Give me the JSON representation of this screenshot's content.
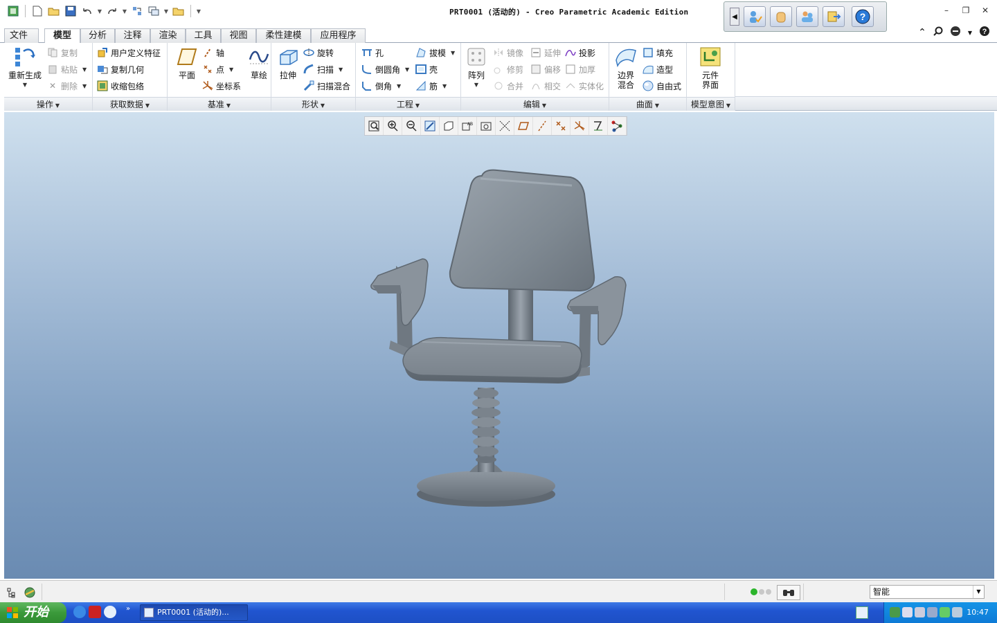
{
  "window": {
    "title": "PRT0001 (活动的) - Creo Parametric Academic Edition"
  },
  "ribbon_tabs": [
    {
      "label": "文件",
      "has_dropdown": true
    },
    {
      "label": "模型",
      "active": true
    },
    {
      "label": "分析"
    },
    {
      "label": "注释"
    },
    {
      "label": "渲染"
    },
    {
      "label": "工具"
    },
    {
      "label": "视图"
    },
    {
      "label": "柔性建模"
    },
    {
      "label": "应用程序"
    }
  ],
  "groups": {
    "operations": {
      "label": "操作",
      "regenerate": "重新生成",
      "copy": "复制",
      "paste": "粘贴",
      "delete": "删除"
    },
    "get_data": {
      "label": "获取数据",
      "udf": "用户定义特征",
      "copy_geom": "复制几何",
      "shrinkwrap": "收缩包络"
    },
    "datum": {
      "label": "基准",
      "plane": "平面",
      "axis": "轴",
      "point": "点",
      "csys": "坐标系",
      "sketch": "草绘"
    },
    "shapes": {
      "label": "形状",
      "extrude": "拉伸",
      "revolve": "旋转",
      "sweep": "扫描",
      "swept_blend": "扫描混合"
    },
    "engineering": {
      "label": "工程",
      "hole": "孔",
      "draft": "拔模",
      "round": "倒圆角",
      "shell": "壳",
      "chamfer": "倒角",
      "rib": "筋"
    },
    "editing": {
      "label": "编辑",
      "pattern": "阵列",
      "mirror": "镜像",
      "extend": "延伸",
      "project": "投影",
      "trim": "修剪",
      "offset": "偏移",
      "thicken": "加厚",
      "merge": "合并",
      "intersect": "相交",
      "solidify": "实体化"
    },
    "surfaces": {
      "label": "曲面",
      "boundary_blend": "边界混合",
      "fill": "填充",
      "style": "造型",
      "freestyle": "自由式"
    },
    "model_intent": {
      "label": "模型意图",
      "component_interface": "元件界面"
    }
  },
  "status": {
    "filter_value": "智能"
  },
  "taskbar": {
    "start_label": "开始",
    "task_item": "PRT0001 (活动的)...",
    "clock": "10:47"
  },
  "colors": {
    "ribbon_accent": "#dfe4ea",
    "viewport_top": "#cfe0ee",
    "viewport_bottom": "#6a8bb2",
    "model_gray": "#7d8791",
    "taskbar_blue": "#2155d0",
    "start_green": "#3b9a3b"
  }
}
